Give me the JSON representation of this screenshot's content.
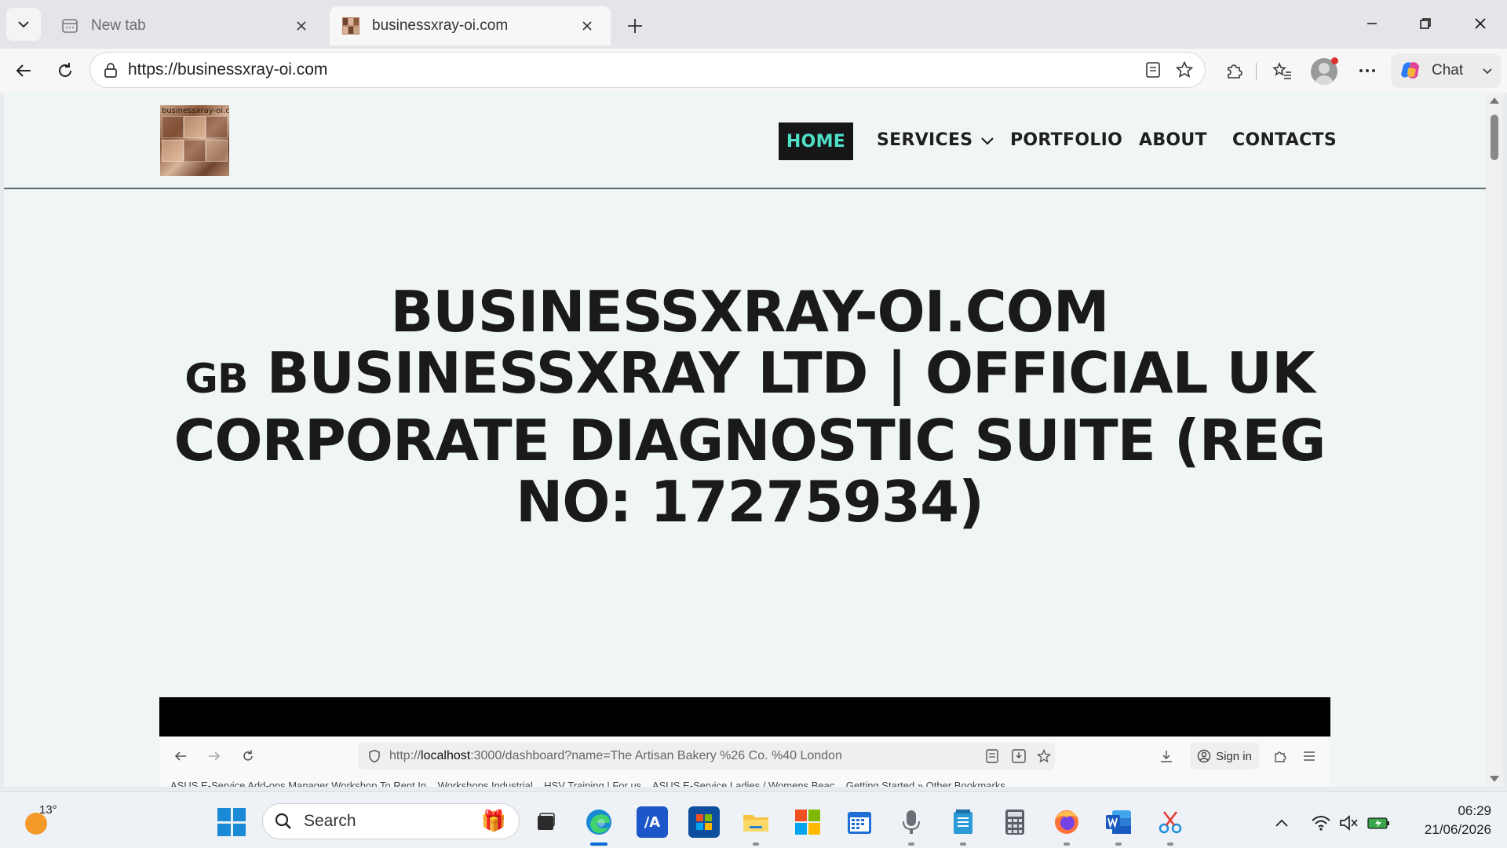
{
  "browser": {
    "tabs": [
      {
        "title": "New tab",
        "active": false,
        "icon": "new-tab-page-icon"
      },
      {
        "title": "businessxray-oi.com",
        "active": true,
        "icon": "site-favicon"
      }
    ],
    "address": {
      "url": "https://businessxray-oi.com"
    },
    "chat_label": "Chat"
  },
  "site": {
    "logo_text": "businessxray-oi.com",
    "nav": {
      "home": "HOME",
      "services": "SERVICES",
      "portfolio": "PORTFOLIO",
      "about": "ABOUT",
      "contacts": "CONTACTS"
    },
    "hero": {
      "title": "BUSINESSXRAY-OI.COM",
      "flag_code": "GB",
      "subtitle": "BUSINESSXRAY LTD | OFFICIAL UK CORPORATE DIAGNOSTIC SUITE (REG NO: 17275934)"
    },
    "embedded_screenshot": {
      "url_prefix": "http://",
      "url_host": "localhost",
      "url_rest": ":3000/dashboard?name=The Artisan Bakery %26 Co. %40 London",
      "sign_in": "Sign in",
      "bookmarks": "ASUS E-Service   Add-ons Manager   Workshop To Rent In...   Workshops Industrial...   HSV Training | For us...   ASUS E-Service   Ladies / Womens Beac...   Getting Started   »   Other Bookmarks"
    }
  },
  "taskbar": {
    "weather_temp": "13°",
    "search_placeholder": "Search",
    "clock_time": "06:29",
    "clock_date": "21/06/2026"
  },
  "colors": {
    "nav_home_bg": "#161616",
    "nav_home_text": "#4fe0c8",
    "page_bg": "#f0f5f5",
    "accent_blue": "#0a6cd6"
  }
}
